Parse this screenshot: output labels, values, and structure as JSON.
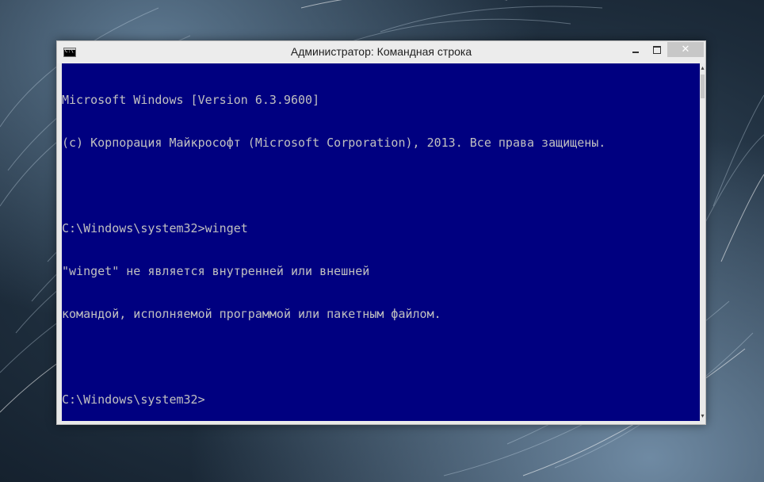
{
  "window": {
    "title": "Администратор: Командная строка",
    "icon": "cmd-icon",
    "icon_text": "C:\\",
    "controls": {
      "minimize": "minimize-icon",
      "maximize": "maximize-icon",
      "close_label": "✕"
    }
  },
  "console": {
    "background": "#000080",
    "foreground": "#c0c0c0",
    "lines": [
      "Microsoft Windows [Version 6.3.9600]",
      "(c) Корпорация Майкрософт (Microsoft Corporation), 2013. Все права защищены.",
      "",
      "C:\\Windows\\system32>winget",
      "\"winget\" не является внутренней или внешней",
      "командой, исполняемой программой или пакетным файлом.",
      "",
      "C:\\Windows\\system32>"
    ]
  },
  "scrollbar": {
    "up_arrow": "▴",
    "down_arrow": "▾"
  }
}
